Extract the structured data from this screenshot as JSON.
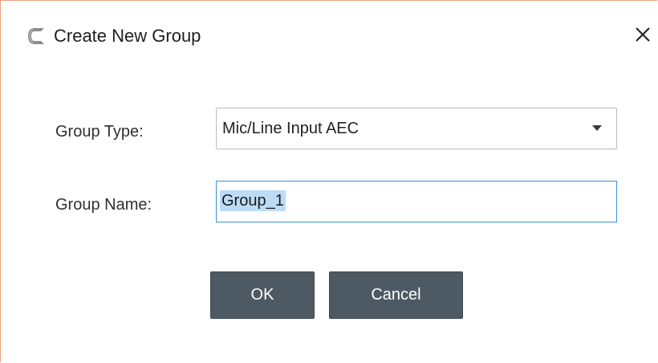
{
  "dialog": {
    "title": "Create New Group",
    "app_icon": "c-logo-icon",
    "close_icon": "close-icon"
  },
  "form": {
    "group_type_label": "Group Type:",
    "group_type_value": "Mic/Line Input AEC",
    "group_name_label": "Group Name:",
    "group_name_value": "Group_1"
  },
  "buttons": {
    "ok_label": "OK",
    "cancel_label": "Cancel"
  },
  "colors": {
    "button_bg": "#4d5a63",
    "focus_border": "#3d8fd6",
    "selection_highlight": "#bcdcf6",
    "window_border": "#e8a27c"
  }
}
